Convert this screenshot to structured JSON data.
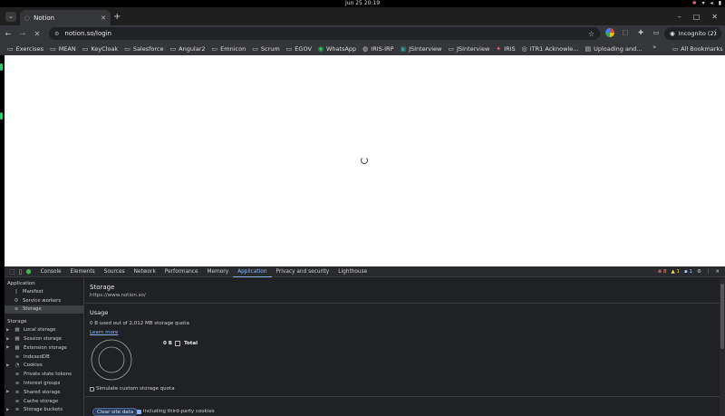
{
  "os": {
    "clock": "Jun 25  20:19"
  },
  "tabs": [
    {
      "title": "Notion"
    }
  ],
  "toolbar": {
    "url": "notion.so/login",
    "incognito_label": "Incognito (2)"
  },
  "bookmarks": [
    {
      "label": "Exercises",
      "icon": "folder-icon"
    },
    {
      "label": "MEAN",
      "icon": "folder-icon"
    },
    {
      "label": "KeyCloak",
      "icon": "folder-icon"
    },
    {
      "label": "Salesforce",
      "icon": "folder-icon"
    },
    {
      "label": "Angular2",
      "icon": "folder-icon"
    },
    {
      "label": "Emnicon",
      "icon": "folder-icon"
    },
    {
      "label": "Scrum",
      "icon": "folder-icon"
    },
    {
      "label": "EGOV",
      "icon": "folder-icon"
    },
    {
      "label": "WhatsApp",
      "icon": "whatsapp-icon"
    },
    {
      "label": "IRIS-IRP",
      "icon": "iris-icon"
    },
    {
      "label": "JSInterview",
      "icon": "jsinterview-icon"
    },
    {
      "label": "JSInterview",
      "icon": "folder-icon"
    },
    {
      "label": "IRIS",
      "icon": "iris-red-icon"
    },
    {
      "label": "ITR1 Acknowle...",
      "icon": "itr-icon"
    },
    {
      "label": "Uploading and...",
      "icon": "uploading-icon"
    }
  ],
  "bookmarks_all": "All Bookmarks",
  "devtools": {
    "tabs": [
      "Console",
      "Elements",
      "Sources",
      "Network",
      "Performance",
      "Memory",
      "Application",
      "Privacy and security",
      "Lighthouse"
    ],
    "active_tab": "Application",
    "status": {
      "errors": "8",
      "warnings": "1",
      "info": "1"
    },
    "sidebar": {
      "application_title": "Application",
      "application_items": [
        {
          "label": "Manifest",
          "icon": "document-icon"
        },
        {
          "label": "Service workers",
          "icon": "gear-icon"
        },
        {
          "label": "Storage",
          "icon": "database-icon",
          "selected": true
        }
      ],
      "storage_title": "Storage",
      "storage_items": [
        {
          "label": "Local storage",
          "icon": "grid-icon",
          "expandable": true
        },
        {
          "label": "Session storage",
          "icon": "grid-icon",
          "expandable": true
        },
        {
          "label": "Extension storage",
          "icon": "grid-icon",
          "expandable": true
        },
        {
          "label": "IndexedDB",
          "icon": "database-icon",
          "expandable": false
        },
        {
          "label": "Cookies",
          "icon": "cookie-icon",
          "expandable": true
        },
        {
          "label": "Private state tokens",
          "icon": "database-icon",
          "expandable": false
        },
        {
          "label": "Interest groups",
          "icon": "database-icon",
          "expandable": false
        },
        {
          "label": "Shared storage",
          "icon": "database-icon",
          "expandable": true
        },
        {
          "label": "Cache storage",
          "icon": "database-icon",
          "expandable": false
        },
        {
          "label": "Storage buckets",
          "icon": "database-icon",
          "expandable": true
        }
      ]
    },
    "storage": {
      "title": "Storage",
      "origin": "https://www.notion.so/",
      "usage_title": "Usage",
      "usage_text": "0 B used out of 2,012 MB storage quota",
      "learn_more": "Learn more",
      "legend_value": "0 B",
      "legend_label": "Total",
      "simulate_label": "Simulate custom storage quota",
      "clear_button": "Clear site data",
      "third_party_label": "including third-party cookies",
      "third_party_checked": true
    }
  }
}
